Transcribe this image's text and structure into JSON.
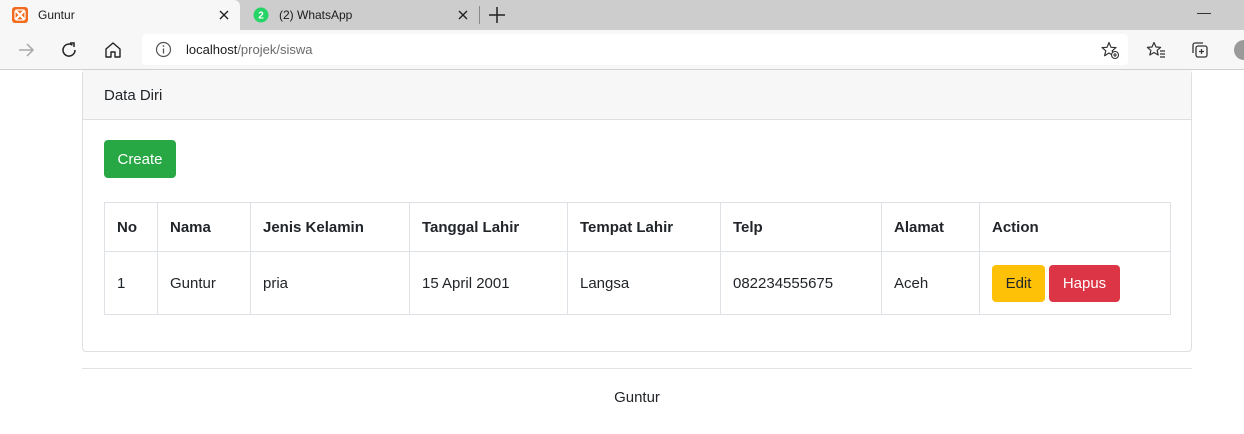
{
  "browser": {
    "tabs": [
      {
        "title": "Guntur",
        "active": true
      },
      {
        "title": "(2) WhatsApp",
        "active": false,
        "badge": "2"
      }
    ],
    "address": {
      "host": "localhost",
      "path": "/projek/siswa"
    }
  },
  "card": {
    "title": "Data Diri",
    "create_label": "Create"
  },
  "table": {
    "headers": [
      "No",
      "Nama",
      "Jenis Kelamin",
      "Tanggal Lahir",
      "Tempat Lahir",
      "Telp",
      "Alamat",
      "Action"
    ],
    "rows": [
      {
        "no": "1",
        "nama": "Guntur",
        "jenis_kelamin": "pria",
        "tanggal_lahir": "15 April 2001",
        "tempat_lahir": "Langsa",
        "telp": "082234555675",
        "alamat": "Aceh",
        "edit_label": "Edit",
        "delete_label": "Hapus"
      }
    ]
  },
  "footer": {
    "text": "Guntur"
  },
  "colors": {
    "create": "#28a745",
    "edit": "#ffc107",
    "delete": "#dc3545",
    "xampp": "#f26b1d",
    "whatsapp": "#25d366"
  }
}
